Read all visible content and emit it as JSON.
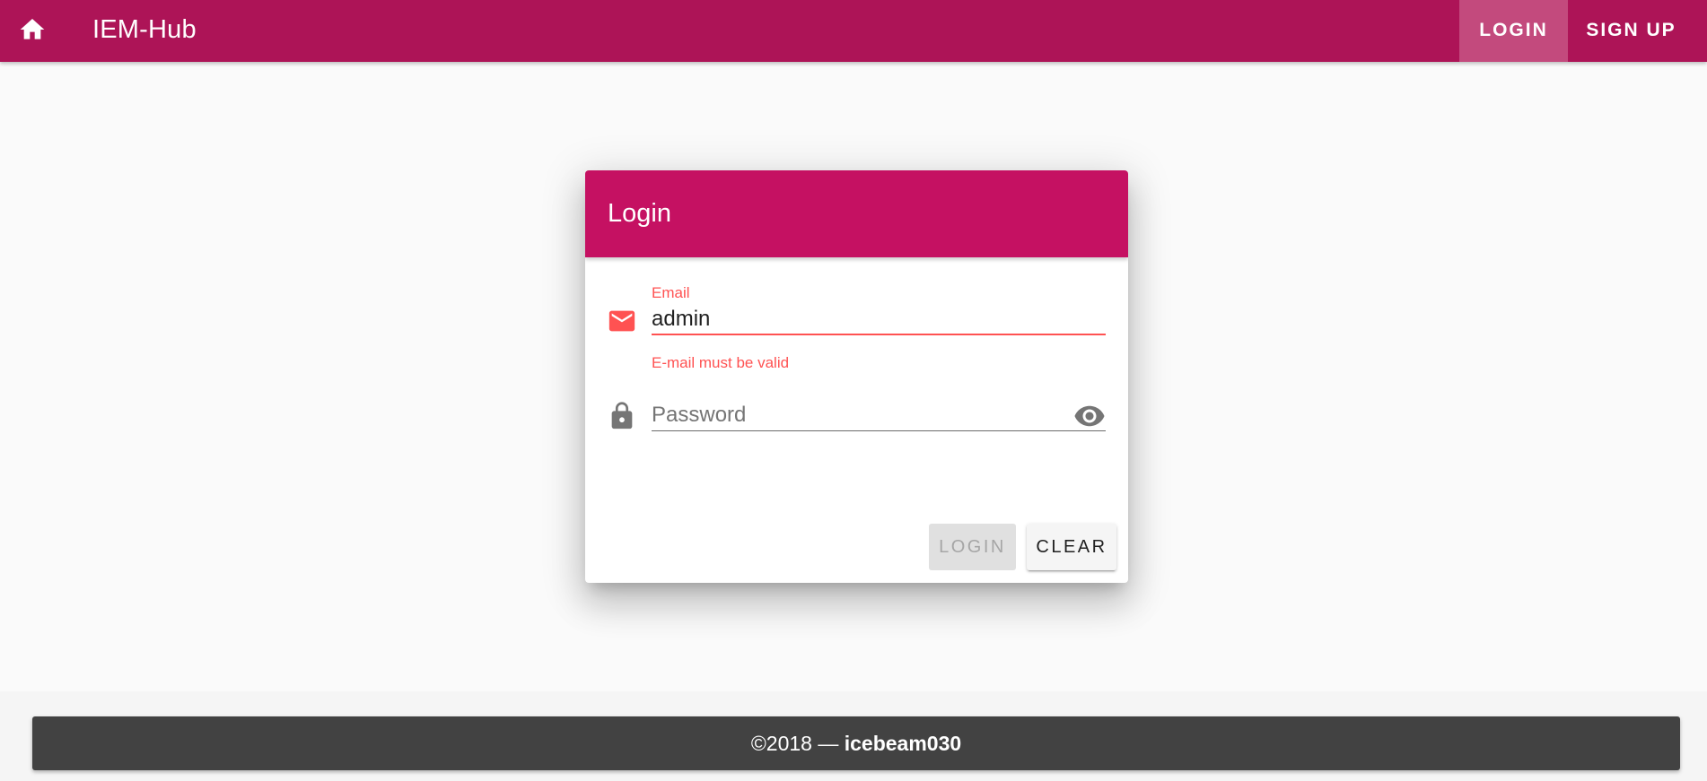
{
  "toolbar": {
    "home_icon": "home-icon",
    "title": "IEM-Hub",
    "login_label": "LOGIN",
    "signup_label": "SIGN UP",
    "color": "#ad1457",
    "active_tab": "login"
  },
  "login_card": {
    "title": "Login",
    "header_color": "#c51162",
    "email": {
      "icon": "email-icon",
      "label": "Email",
      "value": "admin",
      "error": "E-mail must be valid",
      "error_color": "#ff5252"
    },
    "password": {
      "icon": "lock-icon",
      "placeholder": "Password",
      "value": "",
      "toggle_icon": "eye-icon"
    },
    "actions": {
      "login_label": "LOGIN",
      "login_disabled": true,
      "clear_label": "CLEAR"
    }
  },
  "footer": {
    "prefix": "©2018 — ",
    "author": "icebeam030"
  }
}
